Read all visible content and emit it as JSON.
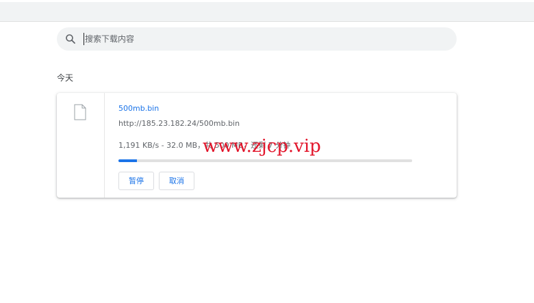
{
  "search": {
    "placeholder": "搜索下载内容"
  },
  "downloads": {
    "date_header": "今天",
    "item": {
      "filename": "500mb.bin",
      "url": "http://185.23.182.24/500mb.bin",
      "status": "1,191 KB/s - 32.0 MB，共 500 MB，还剩 7 分钟",
      "progress_fraction": 0.064,
      "pause_label": "暂停",
      "cancel_label": "取消"
    }
  },
  "watermark": "www.zjcp.vip",
  "colors": {
    "accent": "#1a73e8",
    "watermark": "#e2142a"
  },
  "icons": {
    "search": "search-icon",
    "file": "file-icon"
  }
}
